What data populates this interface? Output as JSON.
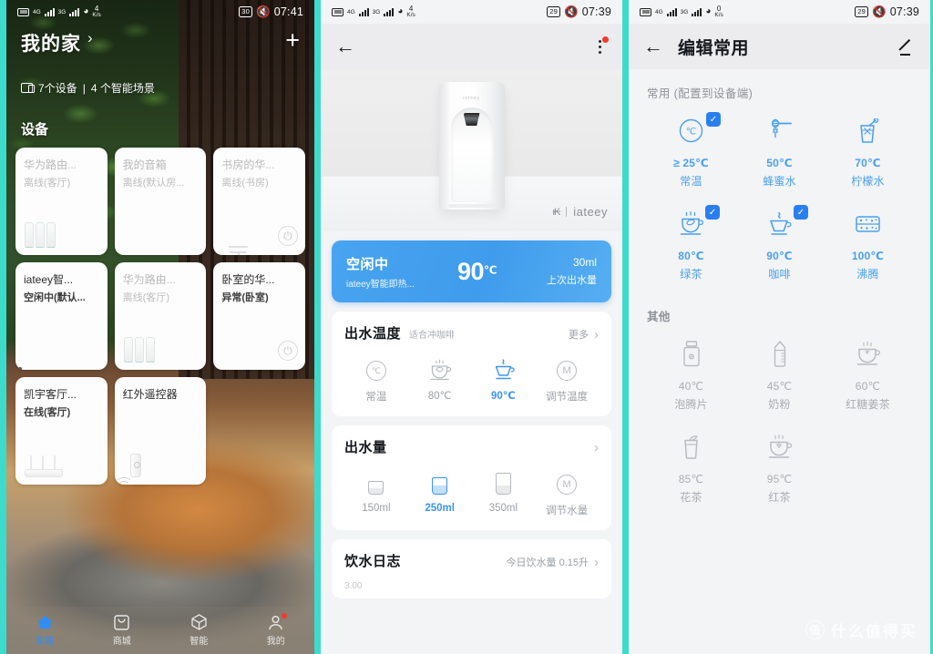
{
  "accents": {
    "frame_teal": "#3DDBCC",
    "primary_blue": "#4BA6F0",
    "check_blue": "#2A7FF0",
    "alert_red": "#F5392F"
  },
  "panel1": {
    "statusbar": {
      "network_a": "4G",
      "network_b": "3G",
      "speed": "4",
      "speed_unit": "K/s",
      "battery": "30",
      "time": "07:41"
    },
    "header": {
      "title": "我的家",
      "chevron": "›",
      "add_label": "+",
      "summary_devices": "7个设备",
      "summary_divider": "|",
      "summary_scenes": "4 个智能场景",
      "section_label": "设备"
    },
    "devices": [
      {
        "name": "华为路由...",
        "status": "离线(客厅)",
        "art": "router",
        "online": false,
        "power": false
      },
      {
        "name": "我的音箱",
        "status": "离线(默认房...",
        "art": "speaker",
        "online": false,
        "power": false
      },
      {
        "name": "书房的华...",
        "status": "离线(书房)",
        "art": "lamp",
        "online": false,
        "power": true
      },
      {
        "name": "iateey智...",
        "status": "空闲中(默认...",
        "art": "purifier",
        "online": true,
        "power": false
      },
      {
        "name": "华为路由...",
        "status": "离线(客厅)",
        "art": "router",
        "online": false,
        "power": false
      },
      {
        "name": "卧室的华...",
        "status": "异常(卧室)",
        "art": "humidifier",
        "online": true,
        "power": true
      },
      {
        "name": "凯宇客厅...",
        "status": "在线(客厅)",
        "art": "wifirouter",
        "online": true,
        "power": false
      },
      {
        "name": "红外遥控器",
        "status": "",
        "art": "remote",
        "online": true,
        "power": false
      }
    ],
    "nav": [
      {
        "label": "家居",
        "icon": "home-icon",
        "active": true,
        "badge": false
      },
      {
        "label": "商城",
        "icon": "store-icon",
        "active": false,
        "badge": false
      },
      {
        "label": "智能",
        "icon": "cube-icon",
        "active": false,
        "badge": false
      },
      {
        "label": "我的",
        "icon": "profile-icon",
        "active": false,
        "badge": true
      }
    ]
  },
  "panel2": {
    "statusbar": {
      "network_a": "4G",
      "network_b": "3G",
      "speed": "4",
      "speed_unit": "K/s",
      "battery": "29",
      "time": "07:39"
    },
    "hero": {
      "device_logo": "iateey",
      "brand_glyph": "ᵼ₭",
      "brand_name": "iateey"
    },
    "status_card": {
      "state": "空闲中",
      "device_name": "iateey智能即热...",
      "temperature": "90",
      "temperature_unit": "℃",
      "volume": "30ml",
      "volume_label": "上次出水量"
    },
    "temp_section": {
      "title": "出水温度",
      "note": "适合冲咖啡",
      "more": "更多",
      "arrow": "›",
      "options": [
        {
          "label": "常温",
          "icon": "thermometer-circle-icon",
          "selected": false
        },
        {
          "label": "80℃",
          "icon": "tea-cup-icon",
          "selected": false
        },
        {
          "label": "90℃",
          "icon": "coffee-cup-icon",
          "selected": true
        },
        {
          "label": "调节温度",
          "icon": "manual-m-icon",
          "selected": false
        }
      ]
    },
    "volume_section": {
      "title": "出水量",
      "arrow": "›",
      "options": [
        {
          "label": "150ml",
          "icon": "small-glass-icon",
          "selected": false
        },
        {
          "label": "250ml",
          "icon": "medium-glass-icon",
          "selected": true
        },
        {
          "label": "350ml",
          "icon": "large-glass-icon",
          "selected": false
        },
        {
          "label": "调节水量",
          "icon": "manual-m-icon",
          "selected": false
        }
      ]
    },
    "log_section": {
      "title": "饮水日志",
      "summary": "今日饮水量 0.15升",
      "arrow": "›",
      "axis_top": "3.00"
    }
  },
  "panel3": {
    "statusbar": {
      "network_a": "4G",
      "network_b": "3G",
      "speed": "0",
      "speed_unit": "K/s",
      "battery": "29",
      "time": "07:39"
    },
    "appbar": {
      "title": "编辑常用",
      "edit_icon": "pencil-icon",
      "back_icon": "back-arrow-icon"
    },
    "favorites": {
      "label": "常用 (配置到设备端)",
      "items": [
        {
          "temp": "≥ 25℃",
          "name": "常温",
          "icon": "thermometer-circle-icon",
          "checked": true
        },
        {
          "temp": "50℃",
          "name": "蜂蜜水",
          "icon": "honey-dipper-icon",
          "checked": false
        },
        {
          "temp": "70℃",
          "name": "柠檬水",
          "icon": "lemonade-glass-icon",
          "checked": false
        },
        {
          "temp": "80℃",
          "name": "绿茶",
          "icon": "green-tea-icon",
          "checked": true
        },
        {
          "temp": "90℃",
          "name": "咖啡",
          "icon": "coffee-cup-icon",
          "checked": true
        },
        {
          "temp": "100℃",
          "name": "沸腾",
          "icon": "boiling-icon",
          "checked": false
        }
      ]
    },
    "others": {
      "label": "其他",
      "items": [
        {
          "temp": "40℃",
          "name": "泡腾片",
          "icon": "tablet-bottle-icon"
        },
        {
          "temp": "45℃",
          "name": "奶粉",
          "icon": "baby-bottle-icon"
        },
        {
          "temp": "60℃",
          "name": "红糖姜茶",
          "icon": "ginger-tea-icon"
        },
        {
          "temp": "85℃",
          "name": "花茶",
          "icon": "flower-tea-icon"
        },
        {
          "temp": "95℃",
          "name": "红茶",
          "icon": "black-tea-icon"
        }
      ]
    },
    "watermark": {
      "mark": "值",
      "text": "什么值得买"
    }
  }
}
